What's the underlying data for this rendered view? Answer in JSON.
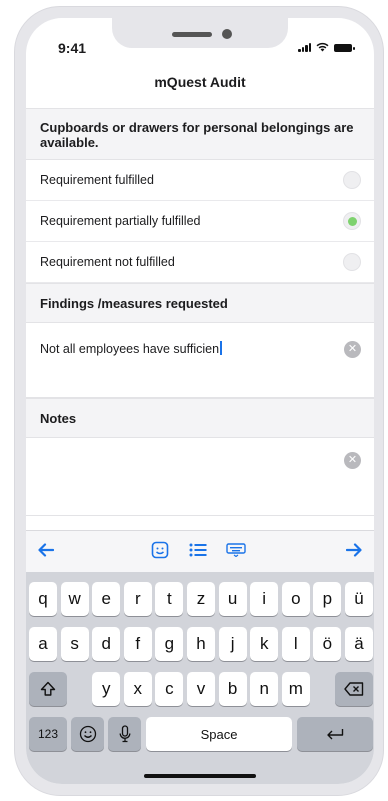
{
  "status_bar": {
    "time": "9:41"
  },
  "nav": {
    "title": "mQuest Audit"
  },
  "question": {
    "text": "Cupboards or drawers for personal belongings are available."
  },
  "options": [
    {
      "label": "Requirement fulfilled",
      "selected": false
    },
    {
      "label": "Requirement partially fulfilled",
      "selected": true
    },
    {
      "label": "Requirement not fulfilled",
      "selected": false
    }
  ],
  "findings": {
    "label": "Findings /measures requested",
    "value": "Not all employees have sufficien"
  },
  "notes": {
    "label": "Notes",
    "value": ""
  },
  "toolbar": {
    "prev_icon": "left-arrow-icon",
    "emoji_icon": "face-icon",
    "list_icon": "list-icon",
    "keyboard_icon": "keyboard-icon",
    "next_icon": "right-arrow-icon"
  },
  "keyboard": {
    "row1": [
      "q",
      "w",
      "e",
      "r",
      "t",
      "z",
      "u",
      "i",
      "o",
      "p",
      "ü"
    ],
    "row2": [
      "a",
      "s",
      "d",
      "f",
      "g",
      "h",
      "j",
      "k",
      "l",
      "ö",
      "ä"
    ],
    "row3": [
      "y",
      "x",
      "c",
      "v",
      "b",
      "n",
      "m"
    ],
    "numbers_label": "123",
    "space_label": "Space"
  },
  "colors": {
    "accent": "#1a73e8",
    "selected_radio": "#7ed26e"
  }
}
